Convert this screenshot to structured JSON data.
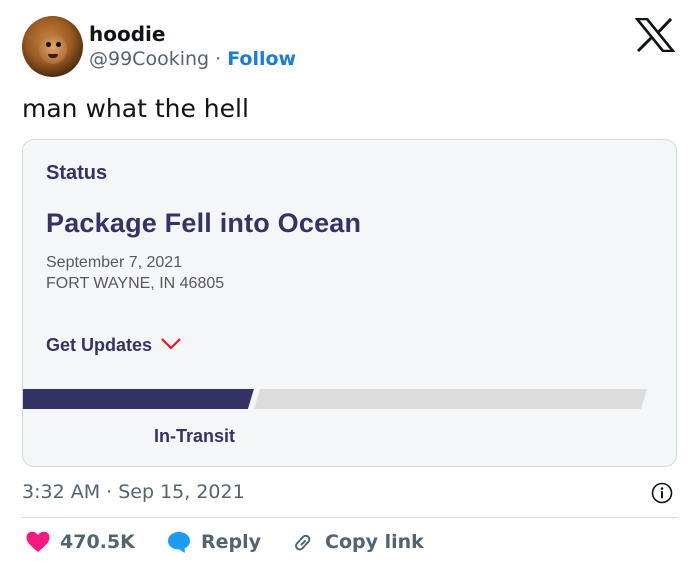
{
  "author": {
    "display_name": "hoodie",
    "handle": "@99Cooking",
    "separator": "·",
    "follow_label": "Follow"
  },
  "brand": {
    "logo": "x-logo-icon"
  },
  "tweet": {
    "text": "man what the hell"
  },
  "card": {
    "status_label": "Status",
    "headline": "Package Fell into Ocean",
    "date": "September 7, 2021",
    "location": "FORT WAYNE, IN 46805",
    "get_updates_label": "Get Updates",
    "progress": {
      "fraction_complete": 0.37,
      "label": "In-Transit"
    }
  },
  "meta": {
    "timestamp": "3:32 AM · Sep 15, 2021"
  },
  "actions": {
    "likes_count": "470.5K",
    "reply_label": "Reply",
    "copy_link_label": "Copy link"
  },
  "colors": {
    "follow": "#1d7bd9",
    "like_heart": "#f91880",
    "reply_bubble": "#1d9bf0",
    "status_navy": "#333366",
    "chevron_red": "#e71921",
    "progress_filled": "#333366",
    "progress_empty": "#dcdcdc"
  }
}
